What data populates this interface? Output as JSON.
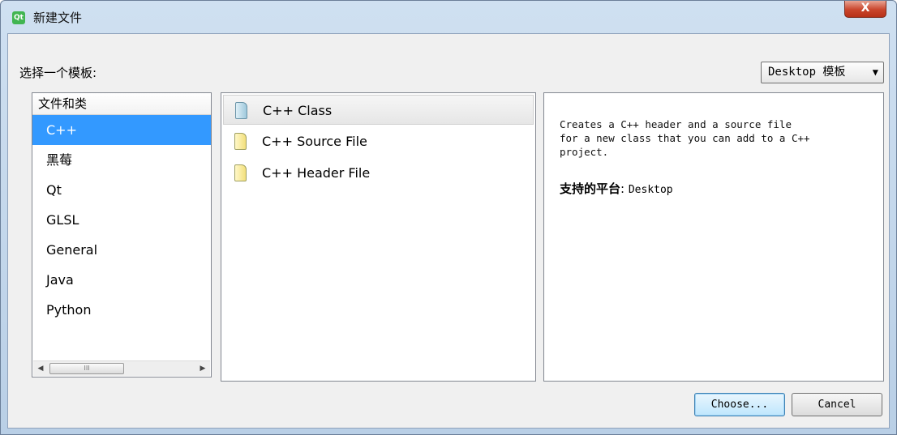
{
  "window": {
    "title": "新建文件",
    "app_icon_text": "Qt",
    "close_label": "X"
  },
  "prompt": "选择一个模板:",
  "platform_select": {
    "value": "Desktop 模板",
    "arrow": "▼"
  },
  "categories": {
    "header": "文件和类",
    "items": [
      "C++",
      "黑莓",
      "Qt",
      "GLSL",
      "General",
      "Java",
      "Python"
    ],
    "selected": "C++",
    "scroll_left": "◀",
    "scroll_right": "▶",
    "scroll_thumb": "III"
  },
  "templates": {
    "items": [
      {
        "label": "C++ Class",
        "icon": "cpp-class-file-icon"
      },
      {
        "label": "C++ Source File",
        "icon": "cpp-source-file-icon"
      },
      {
        "label": "C++ Header File",
        "icon": "cpp-header-file-icon"
      }
    ],
    "selected": "C++ Class"
  },
  "description": {
    "text": "Creates a C++ header and a source file\nfor a new class that you can add to a C++\nproject.",
    "platform_label": "支持的平台",
    "platform_sep": ": ",
    "platform_value": "Desktop"
  },
  "buttons": {
    "choose": "Choose...",
    "cancel": "Cancel"
  },
  "colors": {
    "selection": "#3399ff",
    "close_button": "#c9452c",
    "app_icon": "#41b551"
  }
}
